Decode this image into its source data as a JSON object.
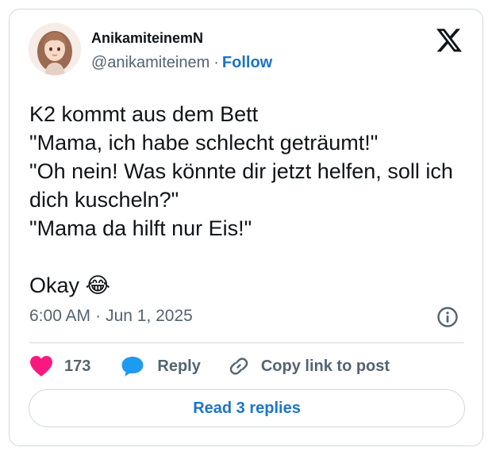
{
  "author": {
    "display_name": "AnikamiteinemN",
    "handle": "@anikamiteinem",
    "separator": "·",
    "follow_label": "Follow",
    "avatar_icon": "avatar-illustration"
  },
  "tweet": {
    "text": "K2 kommt aus dem Bett\n\"Mama, ich habe schlecht geträumt!\"\n\"Oh nein! Was könnte dir jetzt helfen, soll ich dich kuscheln?\"\n\"Mama da hilft nur Eis!\"\n\nOkay 😂",
    "time": "6:00 AM",
    "separator": "·",
    "date": "Jun 1, 2025"
  },
  "actions": {
    "like_count": "173",
    "reply_label": "Reply",
    "copy_label": "Copy link to post",
    "read_replies_label": "Read 3 replies"
  },
  "icons": {
    "platform": "x-logo-icon",
    "info": "info-icon",
    "like": "heart-icon",
    "reply": "speech-bubble-icon",
    "copy": "link-icon"
  },
  "colors": {
    "like": "#f91880",
    "reply": "#1d9bf0",
    "link": "#1d74c7",
    "muted": "#536471",
    "border": "#cfd9de"
  }
}
